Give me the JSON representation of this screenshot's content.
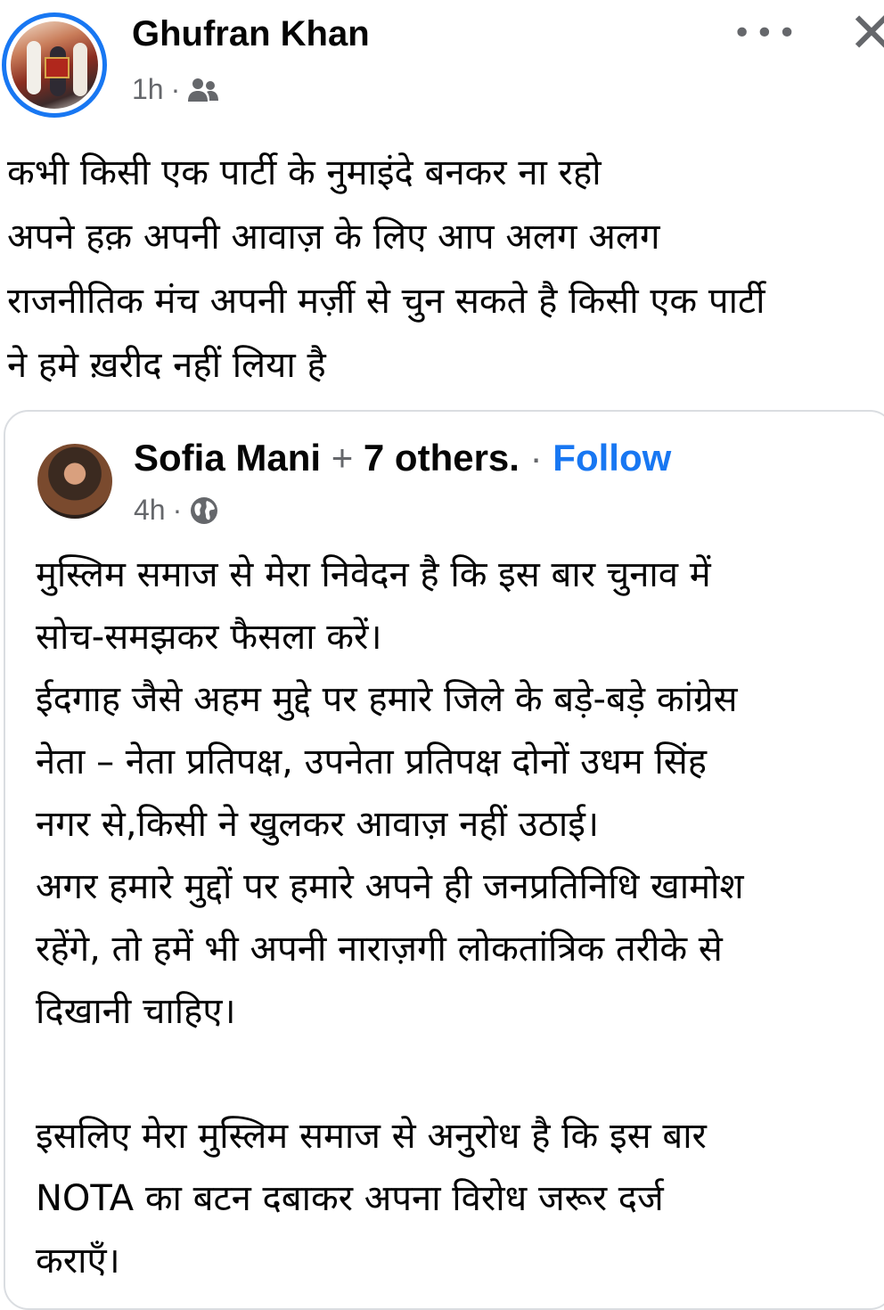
{
  "post": {
    "author": "Ghufran Khan",
    "time": "1h",
    "separator": "·",
    "audience_icon": "friends-icon",
    "more_label": "•••",
    "close_label": "✕",
    "text": "कभी किसी एक पार्टी के नुमाइंदे बनकर ना रहो\nअपने हक़ अपनी आवाज़ के लिए आप अलग अलग\nराजनीतिक मंच अपनी मर्ज़ी से चुन सकते है किसी एक पार्टी\nने हमे ख़रीद नहीं लिया है"
  },
  "shared": {
    "author": "Sofia Mani",
    "plus": " + ",
    "others": "7 others.",
    "dot": " · ",
    "follow": "Follow",
    "time": "4h",
    "separator": "·",
    "audience_icon": "globe-icon",
    "text": "मुस्लिम समाज से मेरा निवेदन है कि इस बार चुनाव में\nसोच-समझकर फैसला करें।\nईदगाह जैसे अहम मुद्दे पर हमारे जिले के बड़े-बड़े कांग्रेस\nनेता – नेता प्रतिपक्ष, उपनेता प्रतिपक्ष दोनों उधम सिंह\nनगर से,किसी ने खुलकर आवाज़ नहीं उठाई।\nअगर हमारे मुद्दों पर हमारे अपने ही जनप्रतिनिधि खामोश\nरहेंगे, तो हमें भी अपनी नाराज़गी लोकतांत्रिक तरीके से\nदिखानी चाहिए।\n\nइसलिए मेरा मुस्लिम समाज से अनुरोध है कि इस बार\nNOTA का बटन दबाकर अपना विरोध जरूर दर्ज\nकराएँ।"
  },
  "colors": {
    "accent": "#1877f2",
    "secondary_text": "#65676b",
    "primary_text": "#050505",
    "border": "#dadde1"
  }
}
